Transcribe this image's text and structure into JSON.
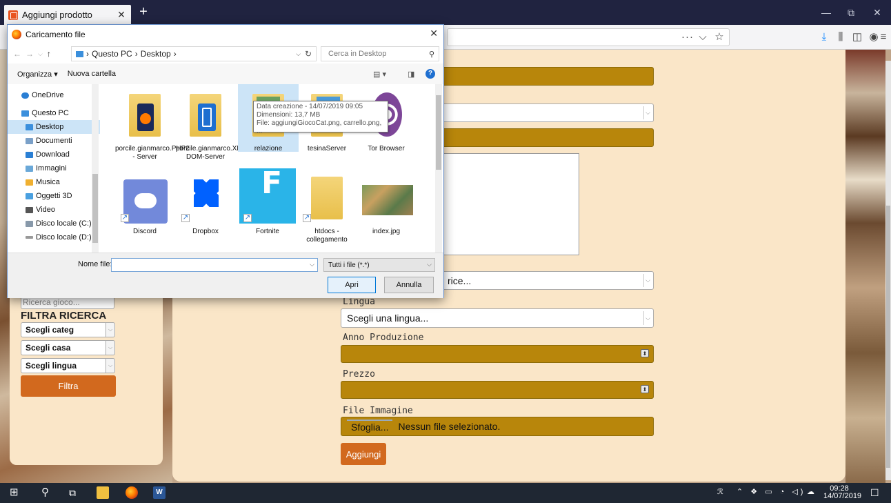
{
  "browser": {
    "tab_title": "Aggiungi prodotto",
    "tab_close": "✕",
    "new_tab": "+",
    "win_min": "—",
    "win_max": "⧉",
    "win_close": "✕",
    "more": "···"
  },
  "dialog": {
    "title": "Caricamento file",
    "close": "✕",
    "breadcrumb": [
      "Questo PC",
      "Desktop"
    ],
    "search_placeholder": "Cerca in Desktop",
    "organize": "Organizza ▾",
    "new_folder": "Nuova cartella",
    "nav_items": [
      {
        "label": "OneDrive",
        "color": "#2a7fd4"
      },
      {
        "label": "Questo PC",
        "color": "#3b8fdc"
      },
      {
        "label": "Desktop",
        "color": "#3b8fdc"
      },
      {
        "label": "Documenti",
        "color": "#7aa0c8"
      },
      {
        "label": "Download",
        "color": "#2a7fd4"
      },
      {
        "label": "Immagini",
        "color": "#6aa8d8"
      },
      {
        "label": "Musica",
        "color": "#f0b030"
      },
      {
        "label": "Oggetti 3D",
        "color": "#4aa0e0"
      },
      {
        "label": "Video",
        "color": "#555555"
      },
      {
        "label": "Disco locale (C:)",
        "color": "#8899aa"
      },
      {
        "label": "Disco locale (D:)",
        "color": "#999999"
      }
    ],
    "files": [
      {
        "name": "porcile.gianmarco.PHP2 - Server"
      },
      {
        "name": "porcile.gianmarco.XML-DOM-Server"
      },
      {
        "name": "relazione"
      },
      {
        "name": "tesinaServer"
      },
      {
        "name": "Tor Browser"
      },
      {
        "name": "Discord"
      },
      {
        "name": "Dropbox"
      },
      {
        "name": "Fortnite"
      },
      {
        "name": "htdocs - collegamento"
      },
      {
        "name": "index.jpg"
      }
    ],
    "tooltip": {
      "line1": "Data creazione - 14/07/2019 09:05",
      "line2": "Dimensioni: 13,7 MB",
      "line3": "File: aggiungiGiocoCat.png, carrello.png, ..."
    },
    "filename_label": "Nome file:",
    "filename_value": "",
    "filter": "Tutti i file (*.*)",
    "open": "Apri",
    "cancel": "Annulla"
  },
  "sidebar": {
    "search_placeholder": "Ricerca gioco...",
    "filter_title": "FILTRA RICERCA",
    "selects": [
      "Scegli categ",
      "Scegli casa",
      "Scegli lingua"
    ],
    "filter_button": "Filtra"
  },
  "form": {
    "partial_select": "rice...",
    "lingua_label": "Lingua",
    "lingua_select": "Scegli una lingua...",
    "anno_label": "Anno Produzione",
    "prezzo_label": "Prezzo",
    "file_label": "File Immagine",
    "browse": "Sfoglia...",
    "no_file": "Nessun file selezionato.",
    "submit": "Aggiungi"
  },
  "taskbar": {
    "time": "09:28",
    "date": "14/07/2019"
  }
}
